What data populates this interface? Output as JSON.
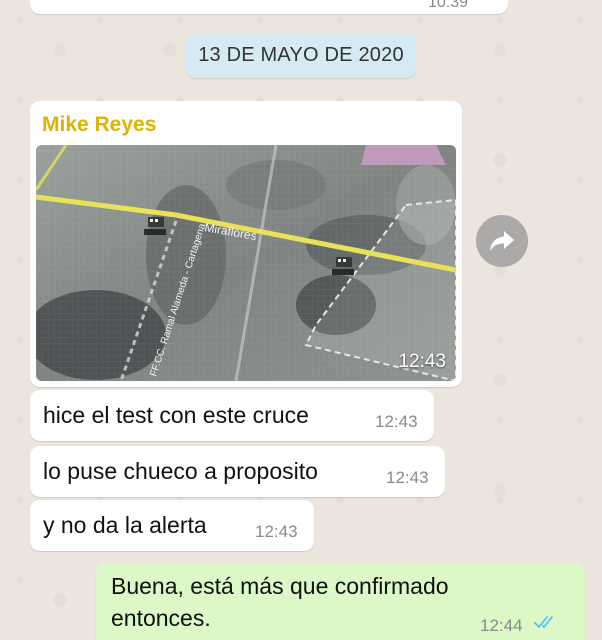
{
  "top_message": {
    "time": "10:39"
  },
  "date_chip": "13 DE MAYO DE 2020",
  "photo_message": {
    "sender": "Mike Reyes",
    "map_labels": {
      "street": "Miraflores",
      "rail": "FF.CC. Ramal Alameda - Cartagena"
    },
    "time": "12:43"
  },
  "incoming": [
    {
      "text": "hice el test con este cruce",
      "time": "12:43"
    },
    {
      "text": "lo puse chueco a proposito",
      "time": "12:43"
    },
    {
      "text": "y no da la alerta",
      "time": "12:43"
    }
  ],
  "outgoing": {
    "line1": "Buena, está más que confirmado",
    "line2": "entonces.",
    "time": "12:44",
    "status_icon": "double-check-read-icon"
  },
  "icons": {
    "forward": "forward-arrow-icon"
  },
  "colors": {
    "sender": "#e0b100",
    "outgoing_bg": "#dcf8c6",
    "ticks": "#4fc3f7",
    "date_chip_bg": "#d5eaf5"
  }
}
